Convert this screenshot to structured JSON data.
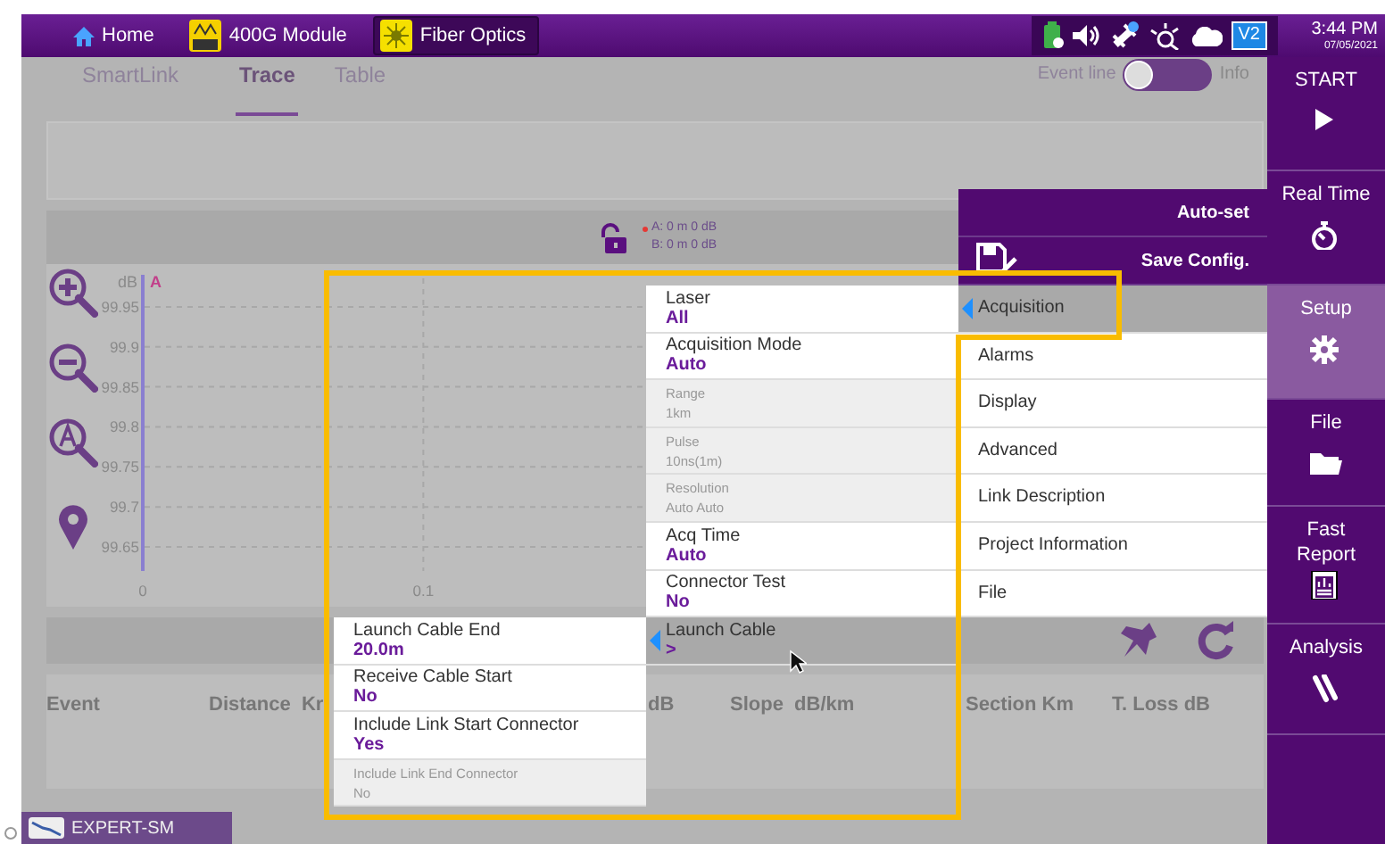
{
  "top_bar": {
    "tabs": [
      {
        "label": "Home",
        "kind": "home",
        "selected": false
      },
      {
        "label": "400G Module",
        "kind": "bert",
        "selected": false
      },
      {
        "label": "Fiber Optics",
        "kind": "fiber",
        "selected": true
      }
    ],
    "badge": "V2",
    "time": "3:44 PM",
    "date": "07/05/2021"
  },
  "view_tabs": [
    {
      "label": "SmartLink",
      "selected": false
    },
    {
      "label": "Trace",
      "selected": true
    },
    {
      "label": "Table",
      "selected": false
    }
  ],
  "event_line": {
    "label": "Event line",
    "on": false,
    "info": "Info"
  },
  "markers": {
    "a": "A: 0 m 0 dB",
    "b": "B: 0 m 0 dB"
  },
  "trace": {
    "marker": "A",
    "chart_data": {
      "type": "line",
      "ylabel": "dB",
      "xlim": [
        0,
        0.397
      ],
      "ylim": [
        99.62,
        99.99
      ],
      "grid": true,
      "yticks": [
        99.95,
        99.9,
        99.85,
        99.8,
        99.75,
        99.7,
        99.65
      ],
      "xticks": [
        0,
        0.1
      ]
    }
  },
  "setup_menu": {
    "actions": [
      {
        "label": "Auto-set",
        "kind": "plain"
      },
      {
        "label": "Save Config.",
        "kind": "save"
      }
    ],
    "items": [
      {
        "label": "Acquisition",
        "selected": true
      },
      {
        "label": "Alarms",
        "selected": false
      },
      {
        "label": "Display",
        "selected": false
      },
      {
        "label": "Advanced",
        "selected": false
      },
      {
        "label": "Link Description",
        "selected": false
      },
      {
        "label": "Project Information",
        "selected": false
      },
      {
        "label": "File",
        "selected": false
      }
    ]
  },
  "acquisition_panel": [
    {
      "label": "Laser",
      "value": "All",
      "disabled": false,
      "selected": false
    },
    {
      "label": "Acquisition Mode",
      "value": "Auto",
      "disabled": false,
      "selected": false
    },
    {
      "label": "Range",
      "value": "1km",
      "disabled": true,
      "selected": false
    },
    {
      "label": "Pulse",
      "value": "10ns(1m)",
      "disabled": true,
      "selected": false
    },
    {
      "label": "Resolution",
      "value": "Auto Auto",
      "disabled": true,
      "selected": false
    },
    {
      "label": "Acq Time",
      "value": "Auto",
      "disabled": false,
      "selected": false
    },
    {
      "label": "Connector Test",
      "value": "No",
      "disabled": false,
      "selected": false
    },
    {
      "label": "Launch Cable",
      "value": ">",
      "disabled": false,
      "selected": true
    }
  ],
  "launch_cable_panel": [
    {
      "label": "Launch Cable End",
      "value": "20.0m",
      "disabled": false
    },
    {
      "label": "Receive Cable Start",
      "value": "No",
      "disabled": false
    },
    {
      "label": "Include Link Start Connector",
      "value": "Yes",
      "disabled": false
    },
    {
      "label": "Include Link End Connector",
      "value": "No",
      "disabled": true
    }
  ],
  "events_table": {
    "columns": [
      "Event",
      "Distance  Kr",
      "dB",
      "Slope  dB/km",
      "Section Km",
      "T. Loss dB"
    ]
  },
  "sidebar": [
    {
      "label": "START",
      "kind": "play",
      "selected": false
    },
    {
      "label": "Real Time",
      "kind": "stopwatch",
      "selected": false
    },
    {
      "label": "Setup",
      "kind": "gear",
      "selected": true
    },
    {
      "label": "File",
      "kind": "folder",
      "selected": false
    },
    {
      "label": "Fast Report",
      "kind": "report",
      "selected": false
    },
    {
      "label": "Analysis",
      "kind": "tools",
      "selected": false
    }
  ],
  "status_tab": {
    "label": "EXPERT-SM"
  }
}
